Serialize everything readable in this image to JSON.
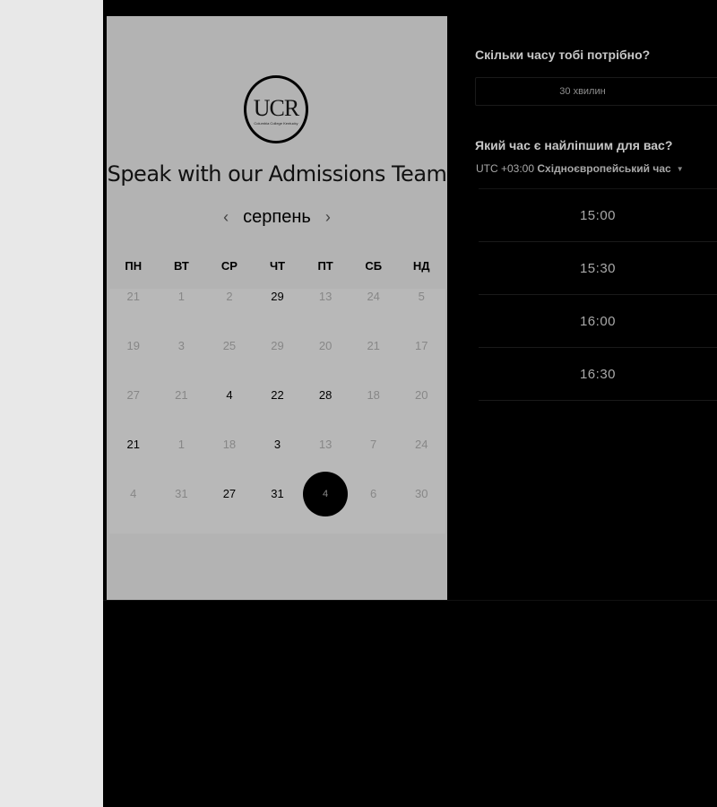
{
  "card": {
    "logo_text": "UCR",
    "logo_subtext": "Columbia College Kentucky",
    "title": "Speak with our Admissions Team",
    "month": "серпень",
    "prev_arrow": "‹",
    "next_arrow": "›",
    "weekdays": [
      "ПН",
      "ВТ",
      "СР",
      "ЧТ",
      "ПТ",
      "СБ",
      "НД"
    ],
    "weeks": [
      [
        {
          "d": "21",
          "a": false
        },
        {
          "d": "1",
          "a": false
        },
        {
          "d": "2",
          "a": false
        },
        {
          "d": "29",
          "a": true
        },
        {
          "d": "13",
          "a": false
        },
        {
          "d": "24",
          "a": false
        },
        {
          "d": "5",
          "a": false
        }
      ],
      [
        {
          "d": "19",
          "a": false
        },
        {
          "d": "3",
          "a": false
        },
        {
          "d": "25",
          "a": false
        },
        {
          "d": "29",
          "a": false
        },
        {
          "d": "20",
          "a": false
        },
        {
          "d": "21",
          "a": false
        },
        {
          "d": "17",
          "a": false
        }
      ],
      [
        {
          "d": "27",
          "a": false
        },
        {
          "d": "21",
          "a": false
        },
        {
          "d": "4",
          "a": true
        },
        {
          "d": "22",
          "a": true
        },
        {
          "d": "28",
          "a": true
        },
        {
          "d": "18",
          "a": false
        },
        {
          "d": "20",
          "a": false
        }
      ],
      [
        {
          "d": "21",
          "a": true
        },
        {
          "d": "1",
          "a": false
        },
        {
          "d": "18",
          "a": false
        },
        {
          "d": "3",
          "a": true
        },
        {
          "d": "13",
          "a": false
        },
        {
          "d": "7",
          "a": false
        },
        {
          "d": "24",
          "a": false
        }
      ],
      [
        {
          "d": "4",
          "a": false
        },
        {
          "d": "31",
          "a": false
        },
        {
          "d": "27",
          "a": true
        },
        {
          "d": "31",
          "a": true
        },
        {
          "d": "4",
          "a": true,
          "selected": true
        },
        {
          "d": "6",
          "a": false
        },
        {
          "d": "30",
          "a": false
        }
      ]
    ]
  },
  "booking": {
    "duration_heading": "Скільки часу тобі потрібно?",
    "duration_value": "30 хвилин",
    "time_heading": "Який час є найліпшим для вас?",
    "timezone_prefix": "UTC +03:00",
    "timezone_name": "Східноєвропейський час",
    "timezone_caret": "▼",
    "slots": [
      "15:00",
      "15:30",
      "16:00",
      "16:30"
    ]
  },
  "colors": {
    "background": "#000000",
    "card": "#b3b3b3",
    "sidebar": "#e8e8e8",
    "selected_day": "#000000"
  }
}
